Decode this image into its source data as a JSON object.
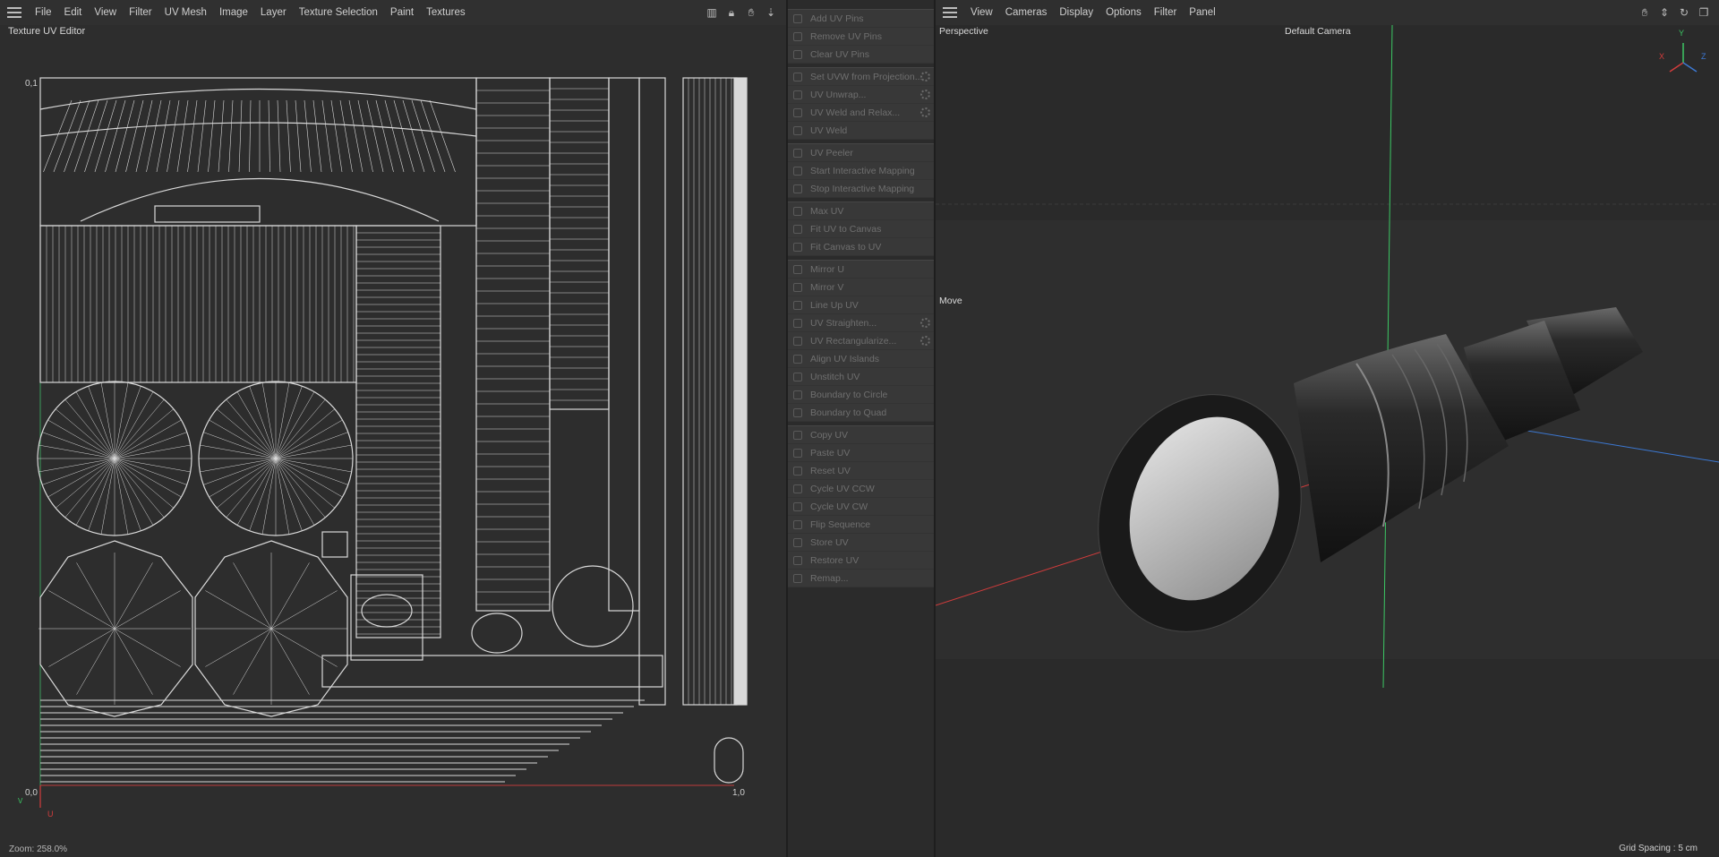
{
  "uv_editor": {
    "menu": [
      "File",
      "Edit",
      "View",
      "Filter",
      "UV Mesh",
      "Image",
      "Layer",
      "Texture Selection",
      "Paint",
      "Textures"
    ],
    "panel_title": "Texture UV Editor",
    "label_top_left": "0,1",
    "label_origin": "0,0",
    "label_bottom_right": "1,0",
    "axis_v": "V",
    "axis_u": "U",
    "zoom": "Zoom: 258.0%",
    "tool_icons": [
      "layout-icon",
      "lock-icon",
      "pan-hand-icon",
      "move-arrow-icon"
    ]
  },
  "commands": {
    "groups": [
      [
        {
          "label": "Add UV Pins"
        },
        {
          "label": "Remove UV Pins"
        },
        {
          "label": "Clear UV Pins"
        }
      ],
      [
        {
          "label": "Set UVW from Projection...",
          "gear": true
        },
        {
          "label": "UV Unwrap...",
          "gear": true
        },
        {
          "label": "UV Weld and Relax...",
          "gear": true
        },
        {
          "label": "UV Weld"
        }
      ],
      [
        {
          "label": "UV Peeler"
        },
        {
          "label": "Start Interactive Mapping"
        },
        {
          "label": "Stop Interactive Mapping"
        }
      ],
      [
        {
          "label": "Max UV"
        },
        {
          "label": "Fit UV to Canvas"
        },
        {
          "label": "Fit Canvas to UV"
        }
      ],
      [
        {
          "label": "Mirror U"
        },
        {
          "label": "Mirror V"
        },
        {
          "label": "Line Up UV"
        },
        {
          "label": "UV Straighten...",
          "gear": true
        },
        {
          "label": "UV Rectangularize...",
          "gear": true
        },
        {
          "label": "Align UV Islands"
        },
        {
          "label": "Unstitch UV"
        },
        {
          "label": "Boundary to Circle"
        },
        {
          "label": "Boundary to Quad"
        }
      ],
      [
        {
          "label": "Copy UV"
        },
        {
          "label": "Paste UV"
        },
        {
          "label": "Reset UV"
        },
        {
          "label": "Cycle UV CCW"
        },
        {
          "label": "Cycle UV CW"
        },
        {
          "label": "Flip Sequence"
        },
        {
          "label": "Store UV"
        },
        {
          "label": "Restore UV"
        },
        {
          "label": "Remap..."
        }
      ]
    ]
  },
  "viewport": {
    "menu": [
      "View",
      "Cameras",
      "Display",
      "Options",
      "Filter",
      "Panel"
    ],
    "projection": "Perspective",
    "camera": "Default Camera",
    "tool": "Move",
    "grid_spacing": "Grid Spacing : 5 cm",
    "axis_x": "X",
    "axis_y": "Y",
    "axis_z": "Z",
    "colors": {
      "x_axis": "#d23c3c",
      "y_axis": "#3cc864",
      "z_axis": "#3c78d2"
    }
  }
}
